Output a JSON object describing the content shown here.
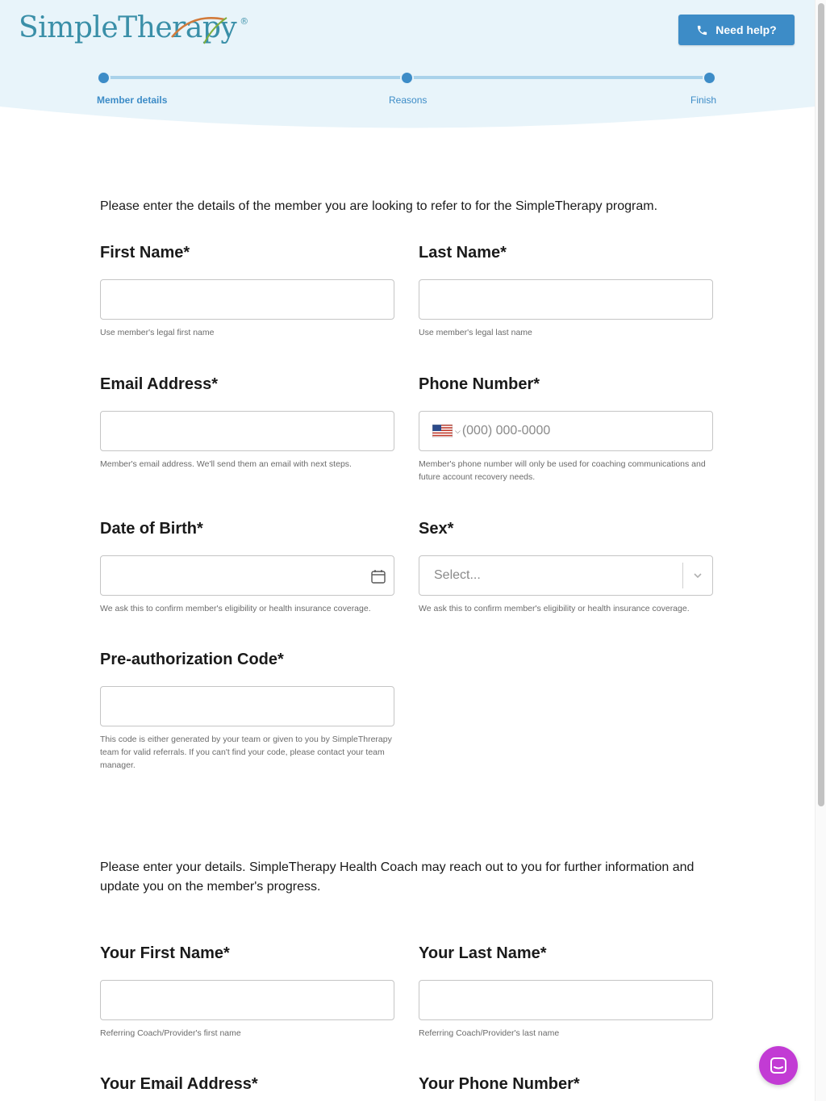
{
  "header": {
    "logo_text": "SimpleTherapy",
    "logo_reg": "®",
    "help_button": "Need help?"
  },
  "steps": [
    {
      "label": "Member details",
      "active": true
    },
    {
      "label": "Reasons",
      "active": false
    },
    {
      "label": "Finish",
      "active": false
    }
  ],
  "member_section": {
    "intro": "Please enter the details of the member you are looking to refer to for the SimpleTherapy program.",
    "first_name": {
      "label": "First Name*",
      "value": "",
      "hint": "Use member's legal first name"
    },
    "last_name": {
      "label": "Last Name*",
      "value": "",
      "hint": "Use member's legal last name"
    },
    "email": {
      "label": "Email Address*",
      "value": "",
      "hint": "Member's email address. We'll send them an email with next steps."
    },
    "phone": {
      "label": "Phone Number*",
      "placeholder": "(000) 000-0000",
      "country": "US",
      "hint": "Member's phone number will only be used for coaching communications and future account recovery needs."
    },
    "dob": {
      "label": "Date of Birth*",
      "value": "",
      "hint": "We ask this to confirm member's eligibility or health insurance coverage."
    },
    "sex": {
      "label": "Sex*",
      "placeholder": "Select...",
      "hint": "We ask this to confirm member's eligibility or health insurance coverage."
    },
    "preauth": {
      "label": "Pre-authorization Code*",
      "value": "",
      "hint": "This code is either generated by your team or given to you by SimpleThrerapy team for valid referrals. If you can't find your code, please contact your team manager."
    }
  },
  "referrer_section": {
    "intro": "Please enter your details. SimpleTherapy Health Coach may reach out to you for further information and update you on the member's progress.",
    "first_name": {
      "label": "Your First Name*",
      "value": "",
      "hint": "Referring Coach/Provider's first name"
    },
    "last_name": {
      "label": "Your Last Name*",
      "value": "",
      "hint": "Referring Coach/Provider's last name"
    },
    "email": {
      "label": "Your Email Address*"
    },
    "phone": {
      "label": "Your Phone Number*"
    }
  },
  "colors": {
    "accent": "#3d8cc7",
    "chat": "#c23bd4",
    "header_bg": "#e6f3fa"
  }
}
